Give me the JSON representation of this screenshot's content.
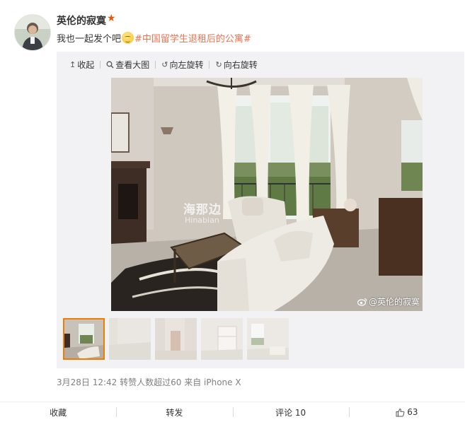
{
  "post": {
    "username": "英伦的寂寞",
    "text_prefix": "我也一起发个吧",
    "topic_hash_open": "#",
    "topic": "中国留学生退租后的公寓",
    "topic_hash_close": "#"
  },
  "icons": {
    "badge": "★",
    "emoji": "smug-face-emoji",
    "collapse": "↥",
    "zoom": "🔍",
    "rotate_left": "↺",
    "rotate_right": "↻",
    "weibo": "weibo-logo",
    "like": "👍"
  },
  "toolbar": {
    "collapse": "收起",
    "view_large": "查看大图",
    "rotate_left": "向左旋转",
    "rotate_right": "向右旋转"
  },
  "photo": {
    "watermark_logo": "海那边",
    "watermark_sub": "Hinabian",
    "credit": "@英伦的寂寞"
  },
  "thumbnails": [
    {
      "subject": "living-room",
      "selected": true
    },
    {
      "subject": "empty-room",
      "selected": false
    },
    {
      "subject": "doorway",
      "selected": false
    },
    {
      "subject": "room-with-shelf",
      "selected": false
    },
    {
      "subject": "window-room",
      "selected": false
    }
  ],
  "meta": {
    "text": "3月28日 12:42 转赞人数超过60 来自 iPhone X"
  },
  "actions": {
    "favorite": "收藏",
    "repost": "转发",
    "comment": "评论 10",
    "like_count": "63"
  },
  "colors": {
    "topic": "#eb7350",
    "badge": "#e8580c",
    "thumb_selected_border": "#f27c00",
    "media_bg": "#f2f2f5",
    "meta": "#808080"
  }
}
